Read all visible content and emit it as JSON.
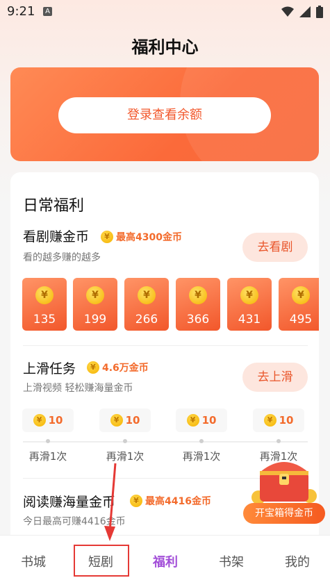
{
  "status_bar": {
    "time": "9:21",
    "app_icon_letter": "A"
  },
  "page_title": "福利中心",
  "login": {
    "button_label": "登录查看余额"
  },
  "daily": {
    "title": "日常福利",
    "watch": {
      "title": "看剧赚金币",
      "tag": "最高4300金币",
      "subtitle": "看的越多赚的越多",
      "button": "去看剧",
      "rewards": [
        "135",
        "199",
        "266",
        "366",
        "431",
        "495"
      ]
    },
    "swipe": {
      "title": "上滑任务",
      "tag": "4.6万金币",
      "subtitle": "上滑视频 轻松赚海量金币",
      "button": "去上滑",
      "chips": [
        {
          "value": "10",
          "label": "再滑1次"
        },
        {
          "value": "10",
          "label": "再滑1次"
        },
        {
          "value": "10",
          "label": "再滑1次"
        },
        {
          "value": "10",
          "label": "再滑1次"
        }
      ]
    },
    "read": {
      "title": "阅读赚海量金币",
      "tag": "最高4416金币",
      "subtitle": "今日最高可赚4416金币"
    }
  },
  "treasure": {
    "label": "开宝箱得金币"
  },
  "coin_symbol": "¥",
  "nav": {
    "items": [
      "书城",
      "短剧",
      "福利",
      "书架",
      "我的"
    ],
    "active_index": 2
  },
  "colors": {
    "accent": "#f86a3b",
    "nav_active": "#a24ed8",
    "highlight": "#e53935"
  }
}
